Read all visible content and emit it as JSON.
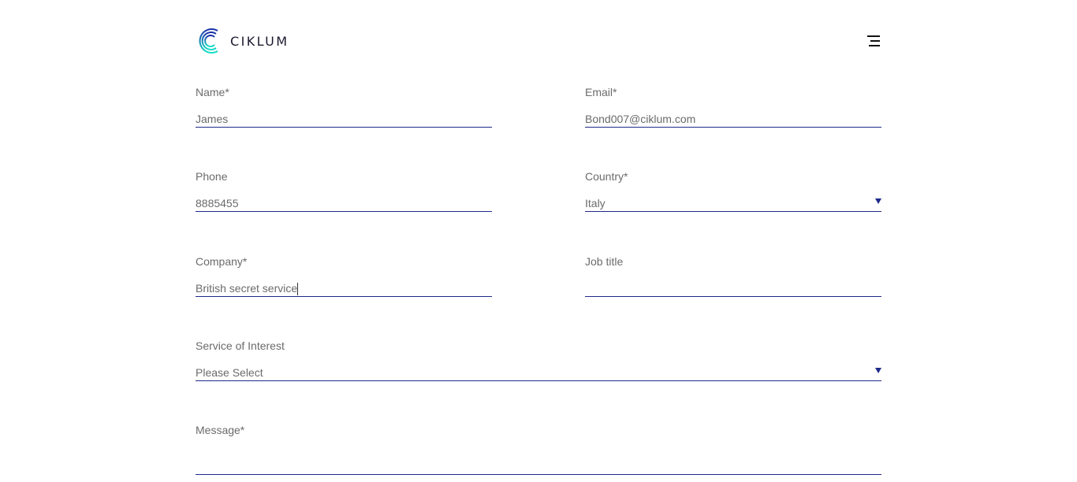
{
  "brand": {
    "name": "CIKLUM",
    "logo_icon": "ciklum-logo-icon",
    "colors": {
      "accent": "#1f2a8a",
      "logo_gradient_start": "#1a2fa8",
      "logo_gradient_end": "#19e0c8"
    }
  },
  "header": {
    "menu_icon": "hamburger-menu-icon"
  },
  "form": {
    "name": {
      "label": "Name*",
      "value": "James"
    },
    "email": {
      "label": "Email*",
      "value": "Bond007@ciklum.com"
    },
    "phone": {
      "label": "Phone",
      "value": "8885455"
    },
    "country": {
      "label": "Country*",
      "value": "Italy"
    },
    "company": {
      "label": "Company*",
      "value": "British secret service"
    },
    "job_title": {
      "label": "Job title",
      "value": ""
    },
    "service": {
      "label": "Service of Interest",
      "value": "Please Select"
    },
    "message": {
      "label": "Message*",
      "value": ""
    }
  }
}
